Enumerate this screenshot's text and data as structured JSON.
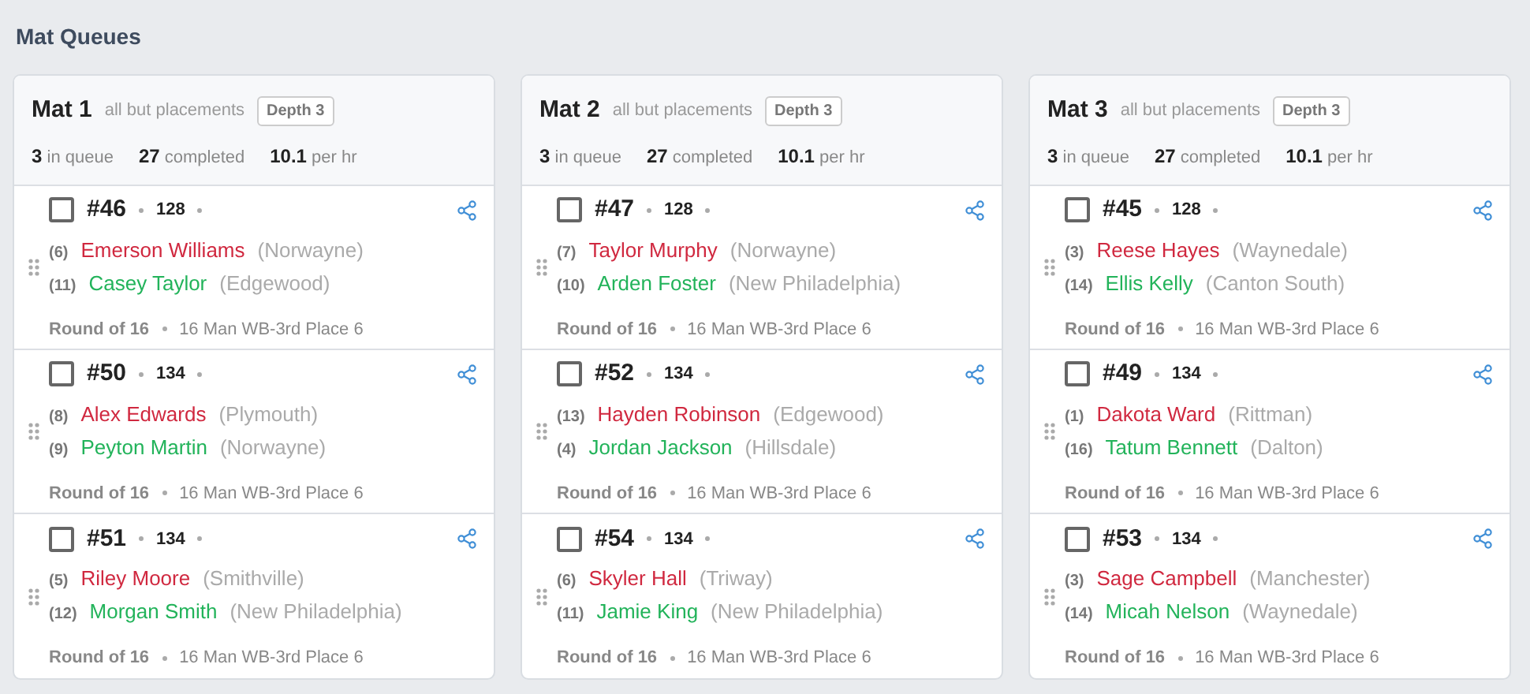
{
  "page_title": "Mat Queues",
  "mats": [
    {
      "name": "Mat 1",
      "filter": "all but placements",
      "depth": "Depth 3",
      "stats": [
        "**3** in queue",
        "**27** completed",
        "**10.1** per hr"
      ],
      "bouts": [
        {
          "number": "#46",
          "checked": false,
          "weight": "128",
          "wrestlers": [
            {
              "kind": "red",
              "seed": "(6)",
              "name": "Emerson Williams",
              "team": "(Norwayne)"
            },
            {
              "kind": "green",
              "seed": "(11)",
              "name": "Casey Taylor",
              "team": "(Edgewood)"
            }
          ],
          "round": "Round of 16",
          "bracket": "16 Man WB-3rd Place 6"
        },
        {
          "number": "#50",
          "checked": false,
          "weight": "134",
          "wrestlers": [
            {
              "kind": "red",
              "seed": "(8)",
              "name": "Alex Edwards",
              "team": "(Plymouth)"
            },
            {
              "kind": "green",
              "seed": "(9)",
              "name": "Peyton Martin",
              "team": "(Norwayne)"
            }
          ],
          "round": "Round of 16",
          "bracket": "16 Man WB-3rd Place 6"
        },
        {
          "number": "#51",
          "checked": false,
          "weight": "134",
          "wrestlers": [
            {
              "kind": "red",
              "seed": "(5)",
              "name": "Riley Moore",
              "team": "(Smithville)"
            },
            {
              "kind": "green",
              "seed": "(12)",
              "name": "Morgan Smith",
              "team": "(New Philadelphia)"
            }
          ],
          "round": "Round of 16",
          "bracket": "16 Man WB-3rd Place 6"
        }
      ]
    },
    {
      "name": "Mat 2",
      "filter": "all but placements",
      "depth": "Depth 3",
      "stats": [
        "**3** in queue",
        "**27** completed",
        "**10.1** per hr"
      ],
      "bouts": [
        {
          "number": "#47",
          "checked": false,
          "weight": "128",
          "wrestlers": [
            {
              "kind": "red",
              "seed": "(7)",
              "name": "Taylor Murphy",
              "team": "(Norwayne)"
            },
            {
              "kind": "green",
              "seed": "(10)",
              "name": "Arden Foster",
              "team": "(New Philadelphia)"
            }
          ],
          "round": "Round of 16",
          "bracket": "16 Man WB-3rd Place 6"
        },
        {
          "number": "#52",
          "checked": false,
          "weight": "134",
          "wrestlers": [
            {
              "kind": "red",
              "seed": "(13)",
              "name": "Hayden Robinson",
              "team": "(Edgewood)"
            },
            {
              "kind": "green",
              "seed": "(4)",
              "name": "Jordan Jackson",
              "team": "(Hillsdale)"
            }
          ],
          "round": "Round of 16",
          "bracket": "16 Man WB-3rd Place 6"
        },
        {
          "number": "#54",
          "checked": false,
          "weight": "134",
          "wrestlers": [
            {
              "kind": "red",
              "seed": "(6)",
              "name": "Skyler Hall",
              "team": "(Triway)"
            },
            {
              "kind": "green",
              "seed": "(11)",
              "name": "Jamie King",
              "team": "(New Philadelphia)"
            }
          ],
          "round": "Round of 16",
          "bracket": "16 Man WB-3rd Place 6"
        }
      ]
    },
    {
      "name": "Mat 3",
      "filter": "all but placements",
      "depth": "Depth 3",
      "stats": [
        "**3** in queue",
        "**27** completed",
        "**10.1** per hr"
      ],
      "bouts": [
        {
          "number": "#45",
          "checked": false,
          "weight": "128",
          "wrestlers": [
            {
              "kind": "red",
              "seed": "(3)",
              "name": "Reese Hayes",
              "team": "(Waynedale)"
            },
            {
              "kind": "green",
              "seed": "(14)",
              "name": "Ellis Kelly",
              "team": "(Canton South)"
            }
          ],
          "round": "Round of 16",
          "bracket": "16 Man WB-3rd Place 6"
        },
        {
          "number": "#49",
          "checked": false,
          "weight": "134",
          "wrestlers": [
            {
              "kind": "red",
              "seed": "(1)",
              "name": "Dakota Ward",
              "team": "(Rittman)"
            },
            {
              "kind": "green",
              "seed": "(16)",
              "name": "Tatum Bennett",
              "team": "(Dalton)"
            }
          ],
          "round": "Round of 16",
          "bracket": "16 Man WB-3rd Place 6"
        },
        {
          "number": "#53",
          "checked": false,
          "weight": "134",
          "wrestlers": [
            {
              "kind": "red",
              "seed": "(3)",
              "name": "Sage Campbell",
              "team": "(Manchester)"
            },
            {
              "kind": "green",
              "seed": "(14)",
              "name": "Micah Nelson",
              "team": "(Waynedale)"
            }
          ],
          "round": "Round of 16",
          "bracket": "16 Man WB-3rd Place 6"
        }
      ]
    }
  ]
}
